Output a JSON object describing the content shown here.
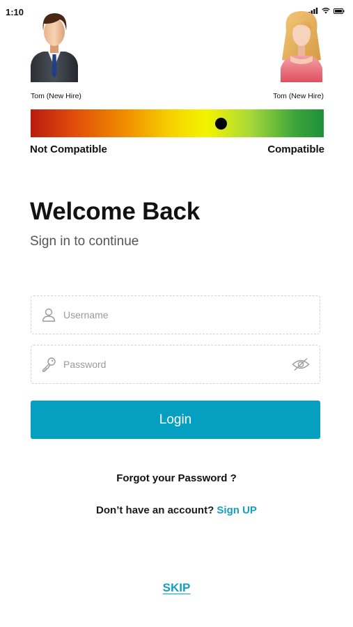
{
  "status_bar": {
    "time": "1:10"
  },
  "profiles": {
    "left": {
      "caption": "Tom (New Hire)",
      "avatar_icon": "male-avatar-icon"
    },
    "right": {
      "caption": "Tom (New Hire)",
      "avatar_icon": "female-avatar-icon"
    }
  },
  "compatibility": {
    "low_label": "Not Compatible",
    "high_label": "Compatible",
    "level": 0.65
  },
  "heading": {
    "title": "Welcome Back",
    "subtitle": "Sign in to continue"
  },
  "form": {
    "username": {
      "placeholder": "Username",
      "value": "",
      "icon": "user-icon"
    },
    "password": {
      "placeholder": "Password",
      "value": "",
      "icon": "key-icon",
      "toggle_icon": "eye-slash-icon"
    },
    "login_label": "Login"
  },
  "links": {
    "forgot": "Forgot your Password ?",
    "no_account": "Don’t have an account?",
    "signup": "Sign UP",
    "skip": "SKIP"
  },
  "colors": {
    "accent": "#05a0c1",
    "link": "#10a0c4",
    "marker": "#050505"
  }
}
